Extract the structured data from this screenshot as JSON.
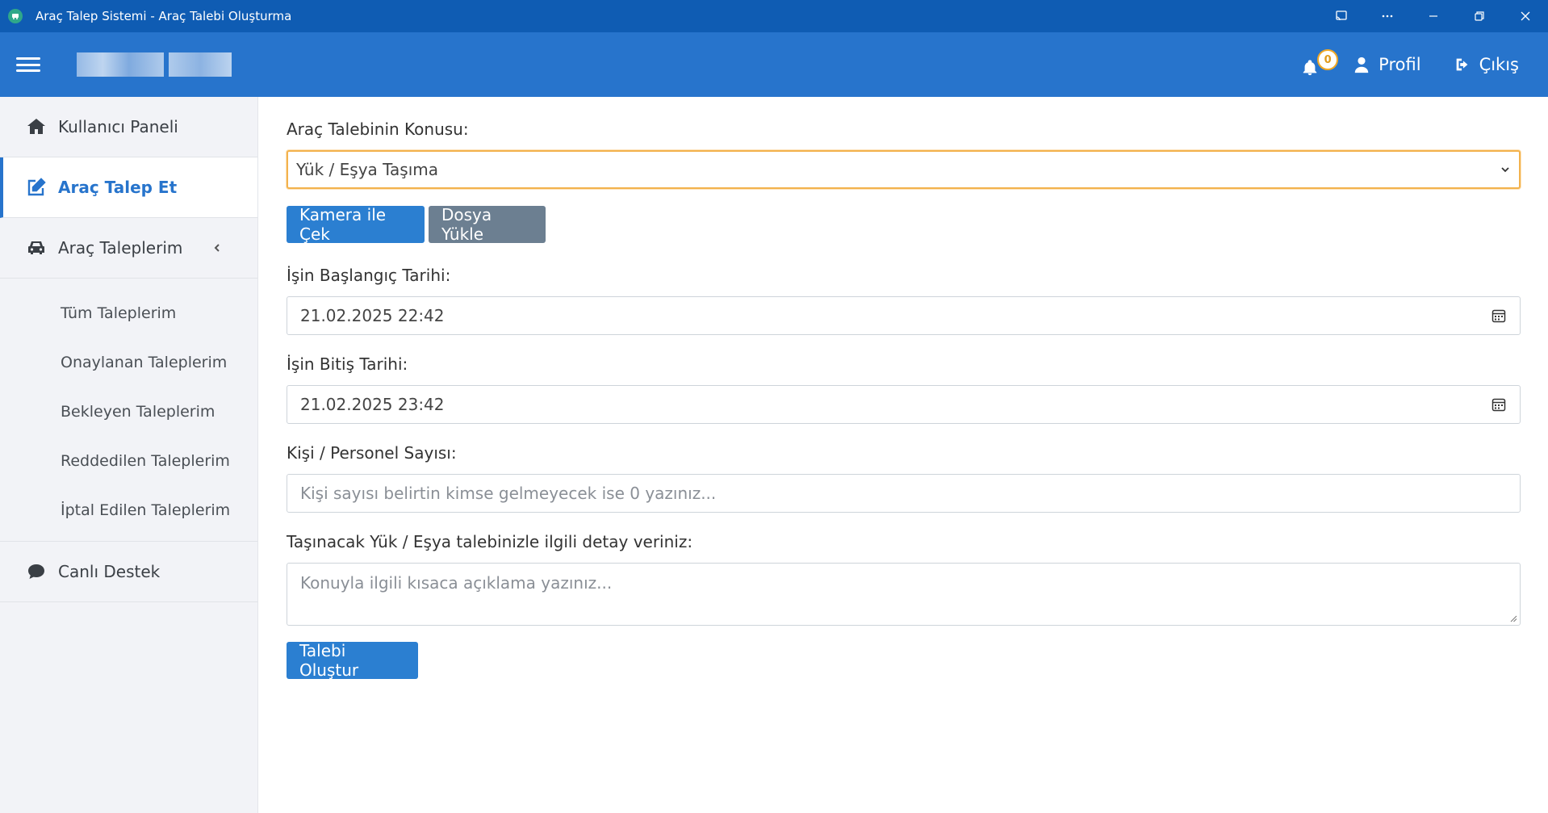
{
  "window": {
    "title": "Araç Talep Sistemi - Araç Talebi Oluşturma"
  },
  "header": {
    "notification_count": "0",
    "profile_label": "Profil",
    "logout_label": "Çıkış"
  },
  "sidebar": {
    "items": [
      {
        "label": "Kullanıcı Paneli",
        "icon": "home-icon"
      },
      {
        "label": "Araç Talep Et",
        "icon": "edit-icon",
        "active": true
      },
      {
        "label": "Araç Taleplerim",
        "icon": "car-icon"
      }
    ],
    "submenu": [
      {
        "label": "Tüm Taleplerim"
      },
      {
        "label": "Onaylanan Taleplerim"
      },
      {
        "label": "Bekleyen Taleplerim"
      },
      {
        "label": "Reddedilen Taleplerim"
      },
      {
        "label": "İptal Edilen Taleplerim"
      }
    ],
    "support": {
      "label": "Canlı Destek",
      "icon": "chat-icon"
    }
  },
  "form": {
    "subject_label": "Araç Talebinin Konusu:",
    "subject_value": "Yük / Eşya Taşıma",
    "camera_button": "Kamera ile Çek",
    "upload_button": "Dosya Yükle",
    "start_label": "İşin Başlangıç Tarihi:",
    "start_value": "21.02.2025 22:42",
    "end_label": "İşin Bitiş Tarihi:",
    "end_value": "21.02.2025 23:42",
    "people_label": "Kişi / Personel Sayısı:",
    "people_placeholder": "Kişi sayısı belirtin kimse gelmeyecek ise 0 yazınız...",
    "detail_label": "Taşınacak Yük / Eşya talebinizle ilgili detay veriniz:",
    "detail_placeholder": "Konuyla ilgili kısaca açıklama yazınız...",
    "submit_button": "Talebi Oluştur"
  },
  "colors": {
    "titlebar": "#0f5cb3",
    "header": "#2774cc",
    "primary": "#2b7fd1",
    "secondary": "#6c7f91",
    "focus": "#f3b24d"
  }
}
